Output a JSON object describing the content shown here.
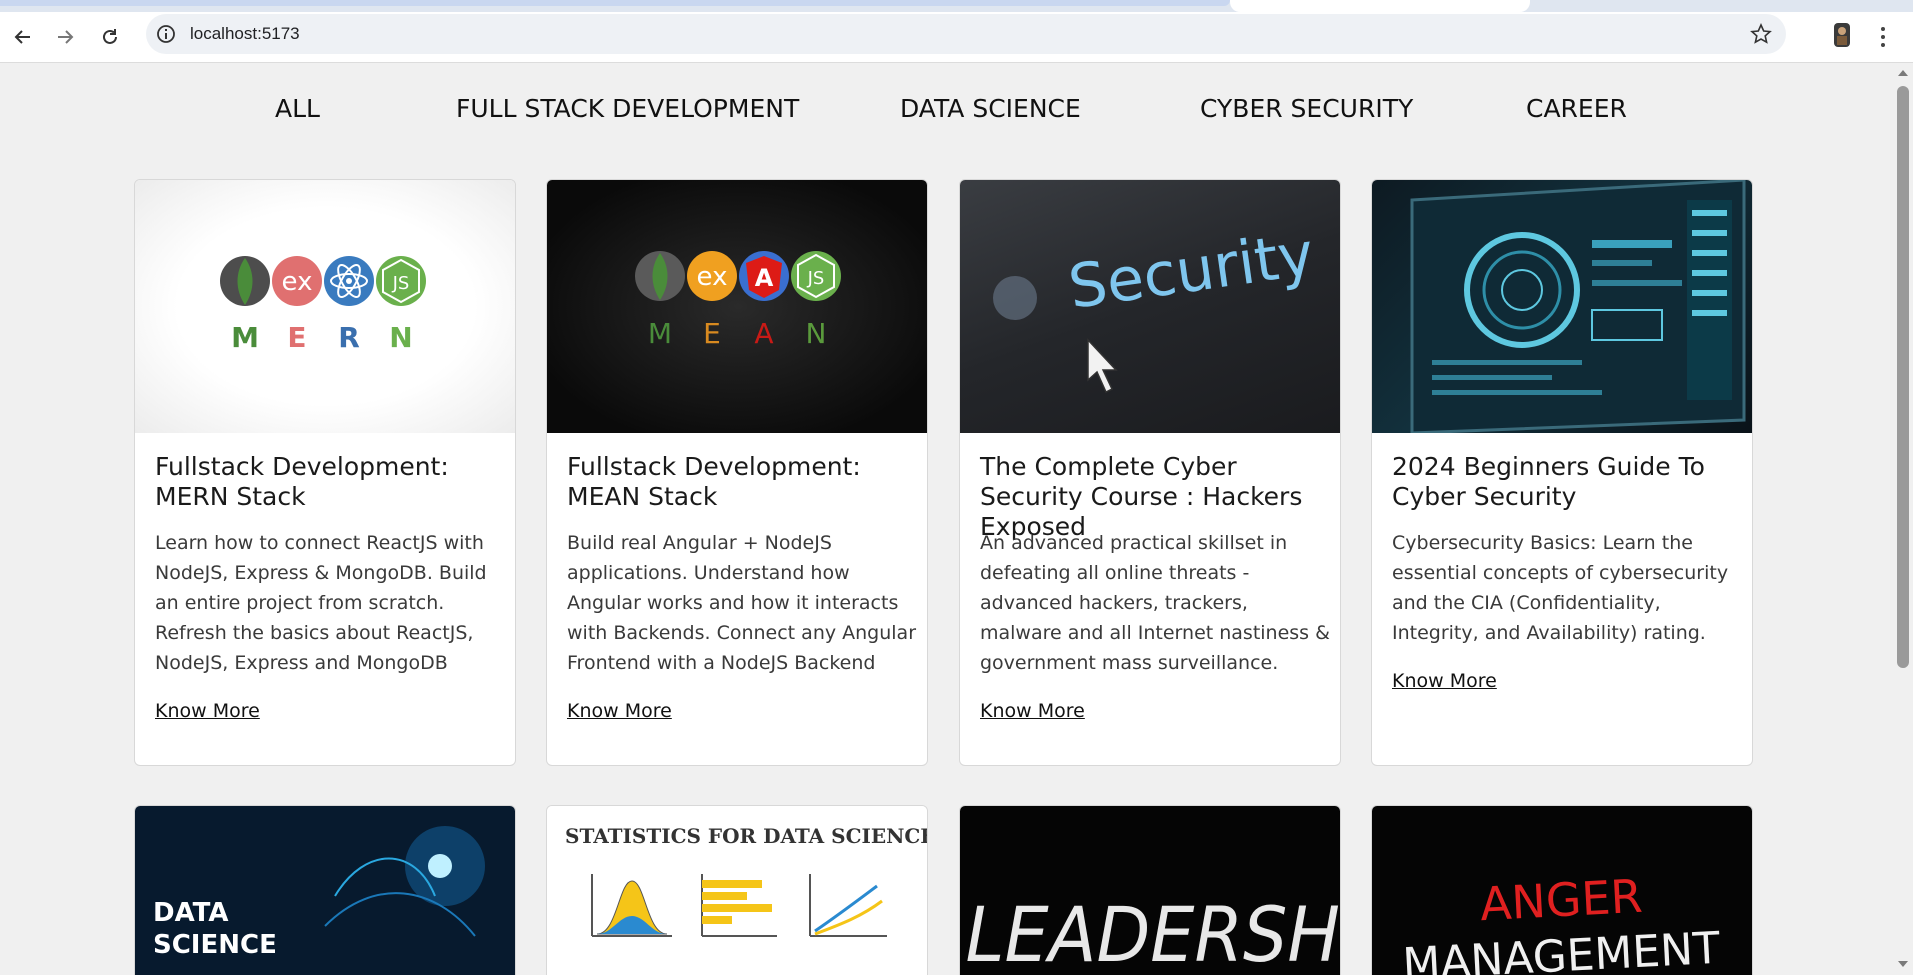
{
  "browser": {
    "url": "localhost:5173"
  },
  "categories": [
    "ALL",
    "FULL STACK DEVELOPMENT",
    "DATA SCIENCE",
    "CYBER SECURITY",
    "CAREER"
  ],
  "courses": [
    {
      "title": "Fullstack Development: MERN Stack",
      "description": "Learn how to connect ReactJS with NodeJS, Express & MongoDB. Build an entire project from scratch. Refresh the basics about ReactJS, NodeJS, Express and MongoDB",
      "link": "Know More",
      "image": {
        "type": "mern-logo",
        "letters": [
          "M",
          "E",
          "R",
          "N"
        ],
        "ex": "ex",
        "js": "JS"
      }
    },
    {
      "title": "Fullstack Development: MEAN Stack",
      "description": "Build real Angular + NodeJS applications. Understand how Angular works and how it interacts with Backends. Connect any Angular Frontend with a NodeJS Backend",
      "link": "Know More",
      "image": {
        "type": "mean-logo",
        "letters": [
          "M",
          "E",
          "A",
          "N"
        ],
        "ex": "ex",
        "a": "A",
        "js": "JS"
      }
    },
    {
      "title": "The Complete Cyber Security Course : Hackers Exposed",
      "description": "An advanced practical skillset in defeating all online threats - advanced hackers, trackers, malware and all Internet nastiness & government mass surveillance.",
      "link": "Know More",
      "image": {
        "type": "security-photo",
        "text": "Security"
      }
    },
    {
      "title": "2024 Beginners Guide To Cyber Security",
      "description": "Cybersecurity Basics: Learn the essential concepts of cybersecurity and the CIA (Confidentiality, Integrity, and Availability) rating.",
      "link": "Know More",
      "image": {
        "type": "monitor-photo"
      }
    }
  ],
  "second_row": [
    {
      "image": {
        "type": "data-science",
        "lines": [
          "DATA",
          "SCIENCE"
        ]
      }
    },
    {
      "image": {
        "type": "statistics",
        "text": "STATISTICS FOR DATA SCIENCE"
      }
    },
    {
      "image": {
        "type": "leadership",
        "text": "LEADERSHIP"
      }
    },
    {
      "image": {
        "type": "anger",
        "lines": [
          "ANGER",
          "MANAGEMENT"
        ]
      }
    }
  ],
  "colors": {
    "page_bg": "#f0f0f0",
    "mongo_green": "#4a8c3a",
    "express_red": "#e05f5f",
    "react_blue": "#3a7bbf",
    "node_green": "#6ab04c",
    "angular_red": "#dd1b16",
    "anger_red": "#e02020"
  }
}
